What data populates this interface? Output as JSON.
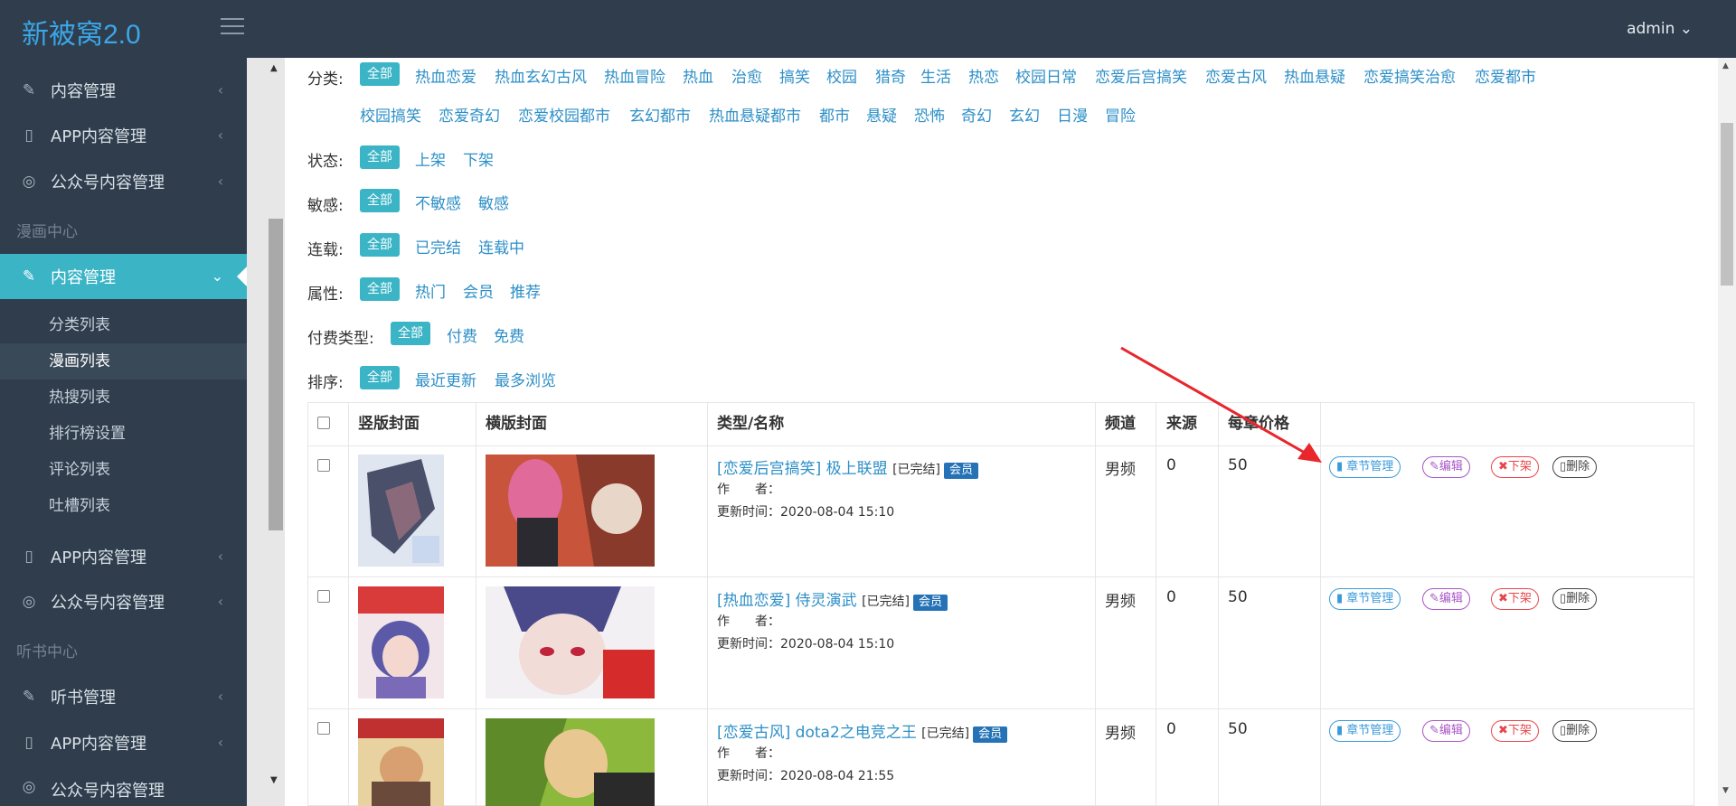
{
  "app": {
    "brand": "新被窝2.0",
    "user": "admin ⌄"
  },
  "sidebar": {
    "top_items": [
      {
        "label": "内容管理",
        "icon": "tag-icon"
      },
      {
        "label": "APP内容管理",
        "icon": "phone-icon"
      },
      {
        "label": "公众号内容管理",
        "icon": "compass-icon"
      }
    ],
    "section_comic": "漫画中心",
    "comic_active": "内容管理",
    "comic_sub": [
      "分类列表",
      "漫画列表",
      "热搜列表",
      "排行榜设置",
      "评论列表",
      "吐槽列表"
    ],
    "comic_more": [
      {
        "label": "APP内容管理",
        "icon": "phone-icon"
      },
      {
        "label": "公众号内容管理",
        "icon": "compass-icon"
      }
    ],
    "section_audio": "听书中心",
    "audio_items": [
      {
        "label": "听书管理",
        "icon": "tag-icon"
      },
      {
        "label": "APP内容管理",
        "icon": "phone-icon"
      },
      {
        "label": "公众号内容管理",
        "icon": "compass-icon"
      }
    ]
  },
  "filters": {
    "category_label": "分类:",
    "all": "全部",
    "categories_row1": [
      "热血恋爱",
      "热血玄幻古风",
      "热血冒险",
      "热血",
      "治愈",
      "搞笑",
      "校园",
      "猎奇",
      "生活",
      "热恋",
      "校园日常",
      "恋爱后宫搞笑",
      "恋爱古风",
      "热血悬疑",
      "恋爱搞笑治愈",
      "恋爱都市"
    ],
    "categories_row2": [
      "校园搞笑",
      "恋爱奇幻",
      "恋爱校园都市",
      "玄幻都市",
      "热血悬疑都市",
      "都市",
      "悬疑",
      "恐怖",
      "奇幻",
      "玄幻",
      "日漫",
      "冒险"
    ],
    "status_label": "状态:",
    "status": [
      "上架",
      "下架"
    ],
    "sensitive_label": "敏感:",
    "sensitive": [
      "不敏感",
      "敏感"
    ],
    "serial_label": "连载:",
    "serial": [
      "已完结",
      "连载中"
    ],
    "attr_label": "属性:",
    "attr": [
      "热门",
      "会员",
      "推荐"
    ],
    "pay_label": "付费类型:",
    "pay": [
      "付费",
      "免费"
    ],
    "sort_label": "排序:",
    "sort": [
      "最近更新",
      "最多浏览"
    ]
  },
  "table": {
    "headers": [
      "竖版封面",
      "横版封面",
      "类型/名称",
      "频道",
      "来源",
      "每章价格"
    ],
    "rows": [
      {
        "title": "[恋爱后宫搞笑] 极上联盟",
        "state": "[已完结]",
        "badge": "会员",
        "author": "作　　者：",
        "updated": "更新时间：2020-08-04 15:10",
        "channel": "男频",
        "source": "0",
        "price": "50"
      },
      {
        "title": "[热血恋爱] 侍灵演武",
        "state": "[已完结]",
        "badge": "会员",
        "author": "作　　者：",
        "updated": "更新时间：2020-08-04 15:10",
        "channel": "男频",
        "source": "0",
        "price": "50"
      },
      {
        "title": "[恋爱古风] dota2之电竞之王",
        "state": "[已完结]",
        "badge": "会员",
        "author": "作　　者：",
        "updated": "更新时间：2020-08-04 21:55",
        "channel": "男频",
        "source": "0",
        "price": "50"
      }
    ],
    "actions": {
      "chapter": "章节管理",
      "edit": "编辑",
      "off": "下架",
      "delete": "删除"
    }
  },
  "colors": {
    "sidebar_bg": "#2f3d4c",
    "accent": "#3bb4c6",
    "link": "#2d8fc7",
    "annotation_arrow": "#e8262b"
  }
}
